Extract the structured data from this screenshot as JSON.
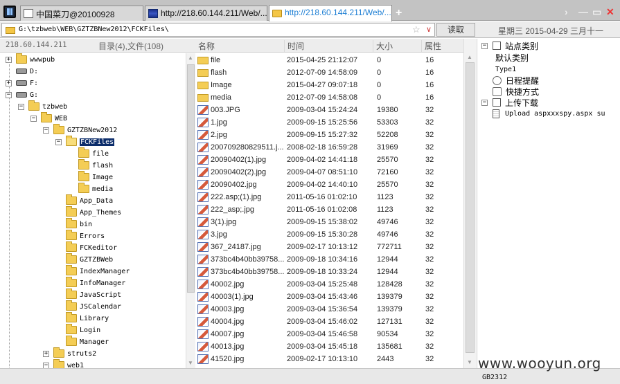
{
  "tabs": [
    {
      "label": "中国菜刀@20100928",
      "icon": "blank-window-icon"
    },
    {
      "label": "http://218.60.144.211/Web/...",
      "icon": "flag-icon"
    },
    {
      "label": "http://218.60.144.211/Web/...",
      "icon": "folder-icon"
    }
  ],
  "window_controls": {
    "arrow": "›",
    "minimize": "—",
    "maximize": "▭",
    "close": "✕"
  },
  "address": {
    "path": "G:\\tzbweb\\WEB\\GZTZBNew2012\\FCKFiles\\",
    "star": "☆",
    "drop": "∨",
    "read_label": "读取",
    "date": "星期三 2015-04-29 三月十一"
  },
  "left": {
    "ip": "218.60.144.211",
    "counts": "目录(4),文件(108)",
    "tree": [
      {
        "label": "wwwpub",
        "type": "folder",
        "exp": "+"
      },
      {
        "label": "D:",
        "type": "drive",
        "exp": ""
      },
      {
        "label": "F:",
        "type": "drive",
        "exp": "+"
      },
      {
        "label": "G:",
        "type": "drive",
        "exp": "−"
      },
      {
        "label": "tzbweb",
        "type": "folder",
        "exp": "−"
      },
      {
        "label": "WEB",
        "type": "folder",
        "exp": "−"
      },
      {
        "label": "GZTZBNew2012",
        "type": "folder",
        "exp": "−"
      },
      {
        "label": "FCKFiles",
        "type": "folder-open",
        "exp": "−",
        "selected": true
      },
      {
        "label": "file",
        "type": "folder",
        "exp": ""
      },
      {
        "label": "flash",
        "type": "folder",
        "exp": ""
      },
      {
        "label": "Image",
        "type": "folder",
        "exp": ""
      },
      {
        "label": "media",
        "type": "folder",
        "exp": ""
      },
      {
        "label": "App_Data",
        "type": "folder",
        "exp": ""
      },
      {
        "label": "App_Themes",
        "type": "folder",
        "exp": ""
      },
      {
        "label": "bin",
        "type": "folder",
        "exp": ""
      },
      {
        "label": "Errors",
        "type": "folder",
        "exp": ""
      },
      {
        "label": "FCKeditor",
        "type": "folder",
        "exp": ""
      },
      {
        "label": "GZTZBWeb",
        "type": "folder",
        "exp": ""
      },
      {
        "label": "IndexManager",
        "type": "folder",
        "exp": ""
      },
      {
        "label": "InfoManager",
        "type": "folder",
        "exp": ""
      },
      {
        "label": "JavaScript",
        "type": "folder",
        "exp": ""
      },
      {
        "label": "JSCalendar",
        "type": "folder",
        "exp": ""
      },
      {
        "label": "Library",
        "type": "folder",
        "exp": ""
      },
      {
        "label": "Login",
        "type": "folder",
        "exp": ""
      },
      {
        "label": "Manager",
        "type": "folder",
        "exp": ""
      },
      {
        "label": "struts2",
        "type": "folder",
        "exp": "+"
      },
      {
        "label": "web1",
        "type": "folder",
        "exp": "−"
      }
    ]
  },
  "list": {
    "headers": {
      "name": "名称",
      "time": "时间",
      "size": "大小",
      "attr": "属性"
    },
    "rows": [
      {
        "name": "file",
        "time": "2015-04-25 21:12:07",
        "size": "0",
        "attr": "16",
        "icon": "folder"
      },
      {
        "name": "flash",
        "time": "2012-07-09 14:58:09",
        "size": "0",
        "attr": "16",
        "icon": "folder"
      },
      {
        "name": "Image",
        "time": "2015-04-27 09:07:18",
        "size": "0",
        "attr": "16",
        "icon": "folder"
      },
      {
        "name": "media",
        "time": "2012-07-09 14:58:08",
        "size": "0",
        "attr": "16",
        "icon": "folder"
      },
      {
        "name": "003.JPG",
        "time": "2009-03-04 15:24:24",
        "size": "19380",
        "attr": "32",
        "icon": "img"
      },
      {
        "name": "1.jpg",
        "time": "2009-09-15 15:25:56",
        "size": "53303",
        "attr": "32",
        "icon": "img"
      },
      {
        "name": "2.jpg",
        "time": "2009-09-15 15:27:32",
        "size": "52208",
        "attr": "32",
        "icon": "img"
      },
      {
        "name": "200709280829511.j...",
        "time": "2008-02-18 16:59:28",
        "size": "31969",
        "attr": "32",
        "icon": "img"
      },
      {
        "name": "20090402(1).jpg",
        "time": "2009-04-02 14:41:18",
        "size": "25570",
        "attr": "32",
        "icon": "img"
      },
      {
        "name": "20090402(2).jpg",
        "time": "2009-04-07 08:51:10",
        "size": "72160",
        "attr": "32",
        "icon": "img"
      },
      {
        "name": "20090402.jpg",
        "time": "2009-04-02 14:40:10",
        "size": "25570",
        "attr": "32",
        "icon": "img"
      },
      {
        "name": "222.asp;(1).jpg",
        "time": "2011-05-16 01:02:10",
        "size": "1123",
        "attr": "32",
        "icon": "img"
      },
      {
        "name": "222_asp;.jpg",
        "time": "2011-05-16 01:02:08",
        "size": "1123",
        "attr": "32",
        "icon": "img"
      },
      {
        "name": "3(1).jpg",
        "time": "2009-09-15 15:38:02",
        "size": "49746",
        "attr": "32",
        "icon": "img"
      },
      {
        "name": "3.jpg",
        "time": "2009-09-15 15:30:28",
        "size": "49746",
        "attr": "32",
        "icon": "img"
      },
      {
        "name": "367_24187.jpg",
        "time": "2009-02-17 10:13:12",
        "size": "772711",
        "attr": "32",
        "icon": "img"
      },
      {
        "name": "373bc4b40bb39758...",
        "time": "2009-09-18 10:34:16",
        "size": "12944",
        "attr": "32",
        "icon": "img"
      },
      {
        "name": "373bc4b40bb39758...",
        "time": "2009-09-18 10:33:24",
        "size": "12944",
        "attr": "32",
        "icon": "img"
      },
      {
        "name": "40002.jpg",
        "time": "2009-03-04 15:25:48",
        "size": "128428",
        "attr": "32",
        "icon": "img"
      },
      {
        "name": "40003(1).jpg",
        "time": "2009-03-04 15:43:46",
        "size": "139379",
        "attr": "32",
        "icon": "img"
      },
      {
        "name": "40003.jpg",
        "time": "2009-03-04 15:36:54",
        "size": "139379",
        "attr": "32",
        "icon": "img"
      },
      {
        "name": "40004.jpg",
        "time": "2009-03-04 15:46:02",
        "size": "127131",
        "attr": "32",
        "icon": "img"
      },
      {
        "name": "40007.jpg",
        "time": "2009-03-04 15:46:58",
        "size": "90534",
        "attr": "32",
        "icon": "img"
      },
      {
        "name": "40013.jpg",
        "time": "2009-03-04 15:45:18",
        "size": "135681",
        "attr": "32",
        "icon": "img"
      },
      {
        "name": "41520.jpg",
        "time": "2009-02-17 10:13:10",
        "size": "2443",
        "attr": "32",
        "icon": "img"
      }
    ]
  },
  "right": {
    "nodes": [
      {
        "label": "站点类别",
        "kind": "group",
        "exp": "−"
      },
      {
        "label": "默认类别",
        "kind": "item",
        "exp": ""
      },
      {
        "label": "Type1",
        "kind": "item-mono",
        "exp": ""
      },
      {
        "label": "日程提醒",
        "kind": "clock",
        "exp": ""
      },
      {
        "label": "快捷方式",
        "kind": "hand",
        "exp": ""
      },
      {
        "label": "上传下载",
        "kind": "group",
        "exp": "−"
      },
      {
        "label": "Upload aspxxxspy.aspx su",
        "kind": "doc",
        "exp": ""
      }
    ]
  },
  "status": {
    "encoding": "GB2312",
    "watermark": "www.wooyun.org"
  }
}
